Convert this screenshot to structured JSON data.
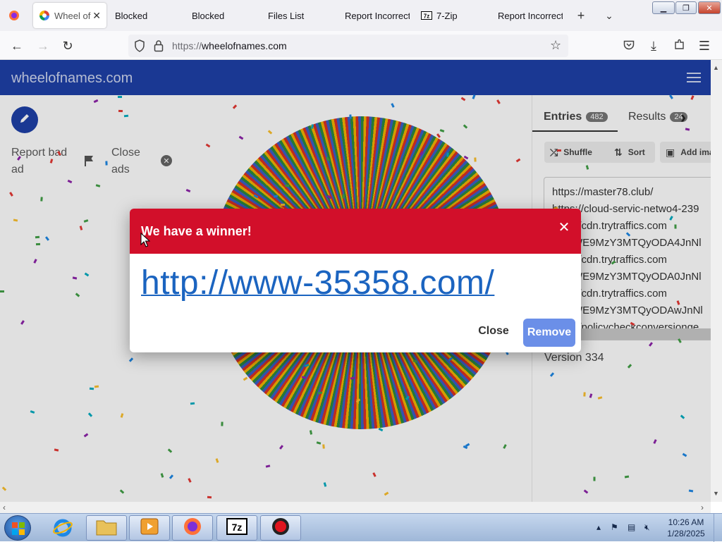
{
  "browser": {
    "tabs": [
      {
        "label": "",
        "icon": "firefox-icon"
      },
      {
        "label": "Wheel of",
        "icon": "wheelofnames-icon",
        "active": true
      },
      {
        "label": "Blocked"
      },
      {
        "label": "Blocked"
      },
      {
        "label": "Files List"
      },
      {
        "label": "Report Incorrect"
      },
      {
        "label": "7-Zip",
        "icon": "7zip-icon"
      },
      {
        "label": "Report Incorrect"
      }
    ],
    "url_protocol": "https://",
    "url_host": "wheelofnames.com"
  },
  "site": {
    "title": "wheelofnames.com",
    "report_bad_ad": "Report bad ad",
    "close_ads": "Close ads"
  },
  "panel": {
    "tabs": [
      {
        "label": "Entries",
        "count": "482"
      },
      {
        "label": "Results",
        "count": "24"
      }
    ],
    "buttons": [
      "Shuffle",
      "Sort",
      "Add ima"
    ],
    "entries": [
      "https://master78.club/",
      "https://cloud-servic-netwo4-239",
      "://cdn.trytraffics.com",
      "WE9MzY3MTQyODA4JnNl",
      "://cdn.trytraffics.com",
      "WE9MzY3MTQyODA0JnNl",
      "://cdn.trytraffics.com",
      "WE9MzY3MTQyODAwJnNl",
      "://policycheckconversionge"
    ],
    "version": "Version 334"
  },
  "dialog": {
    "title": "We have a winner!",
    "winner": "http://www-35358.com/",
    "close_label": "Close",
    "remove_label": "Remove"
  },
  "taskbar": {
    "time": "10:26 AM",
    "date": "1/28/2025"
  },
  "colors": {
    "brand_blue": "#1e40a8",
    "dialog_red": "#d20f2a",
    "link_blue": "#1b64c0",
    "remove_button": "#6b8fe8"
  }
}
